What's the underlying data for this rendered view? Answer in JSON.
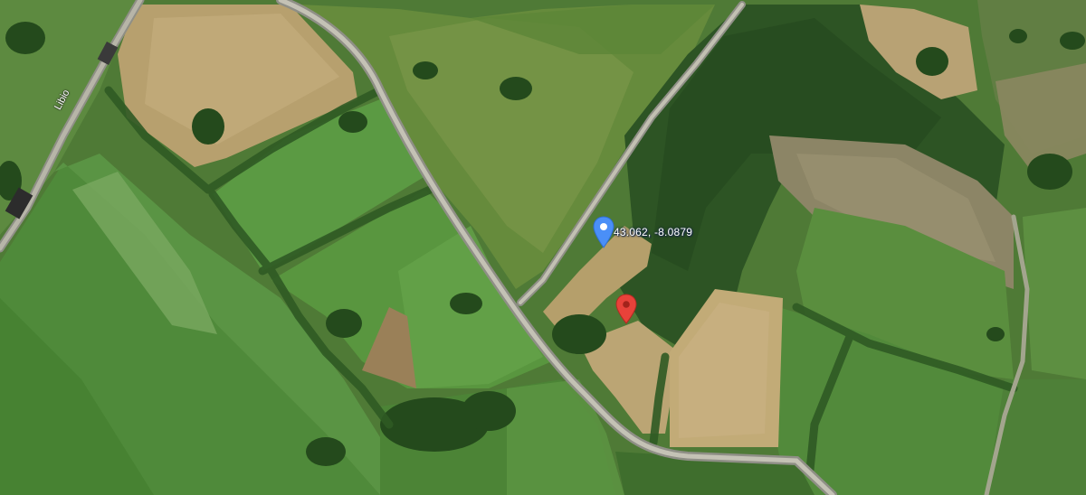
{
  "map": {
    "type": "satellite",
    "coordinate_label": "43.062, -8.0879",
    "road_label": "Libio",
    "markers": [
      {
        "name": "coordinate-marker",
        "color": "#4a8ff7",
        "icon": "map-pin-icon"
      },
      {
        "name": "destination-marker",
        "color": "#e8423a",
        "icon": "map-pin-icon"
      }
    ]
  }
}
